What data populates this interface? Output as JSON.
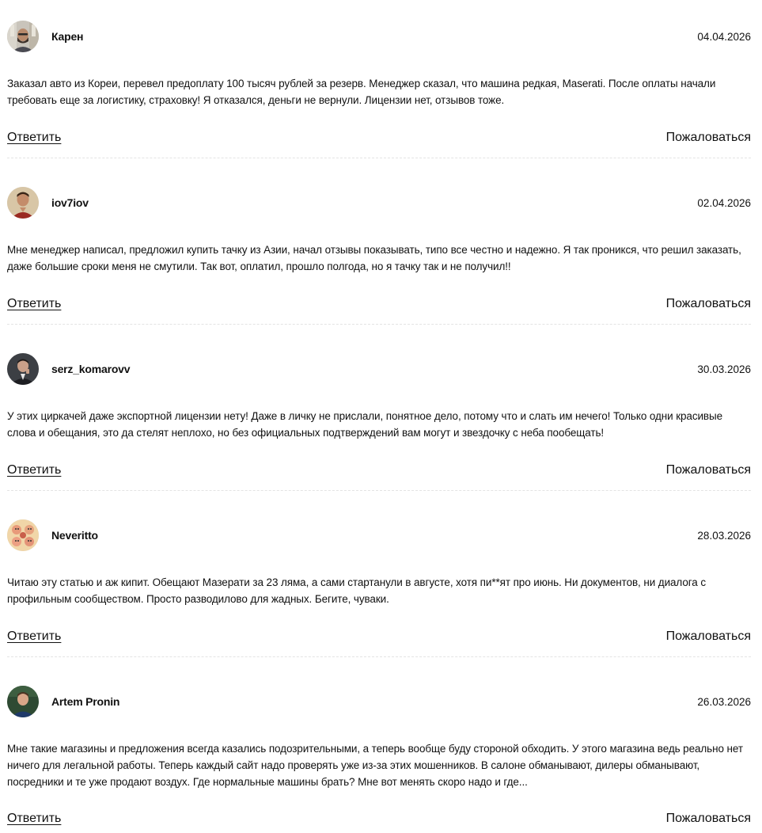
{
  "comments": [
    {
      "username": "Карен",
      "date": "04.04.2026",
      "text": "Заказал авто из Кореи, перевел предоплату 100 тысяч рублей за резерв. Менеджер сказал, что машина редкая, Maserati. После оплаты начали требовать еще за логистику, страховку! Я отказался, деньги не вернули. Лицензии нет, отзывов тоже.",
      "reply_label": "Ответить",
      "report_label": "Пожаловаться",
      "avatar_icon": "bearded-man-avatar"
    },
    {
      "username": "iov7iov",
      "date": "02.04.2026",
      "text": "Мне менеджер написал, предложил купить тачку из Азии, начал отзывы показывать, типо все честно и надежно. Я так проникся, что решил заказать, даже большие сроки меня не смутили. Так вот, оплатил, прошло полгода, но я тачку так и не получил!!",
      "reply_label": "Ответить",
      "report_label": "Пожаловаться",
      "avatar_icon": "man-red-shirt-avatar"
    },
    {
      "username": "serz_komarovv",
      "date": "30.03.2026",
      "text": "У этих циркачей даже экспортной лицензии нету! Даже в личку не прислали, понятное дело, потому что и слать им нечего! Только одни красивые слова и обещания, это да стелят неплохо, но без официальных подтверждений вам могут и звездочку с неба пообещать!",
      "reply_label": "Ответить",
      "report_label": "Пожаловаться",
      "avatar_icon": "man-suit-avatar"
    },
    {
      "username": "Neveritto",
      "date": "28.03.2026",
      "text": "Читаю эту статью и аж кипит. Обещают Мазерати за 23 ляма, а сами стартанули в августе, хотя пи**ят про июнь. Ни документов, ни диалога с профильным сообществом. Просто разводилово для жадных. Бегите, чуваки.",
      "reply_label": "Ответить",
      "report_label": "Пожаловаться",
      "avatar_icon": "cartoon-group-avatar"
    },
    {
      "username": "Artem Pronin",
      "date": "26.03.2026",
      "text": "Мне такие магазины и предложения всегда казались подозрительными, а теперь вообще буду стороной обходить. У этого магазина ведь реально нет ничего для легальной работы. Теперь каждый сайт надо проверять уже из-за этих мошенников. В салоне обманывают, дилеры обманывают, посредники и те уже продают воздух. Где нормальные машины брать? Мне вот менять скоро надо и где...",
      "reply_label": "Ответить",
      "report_label": "Пожаловаться",
      "avatar_icon": "man-outdoor-avatar"
    }
  ]
}
